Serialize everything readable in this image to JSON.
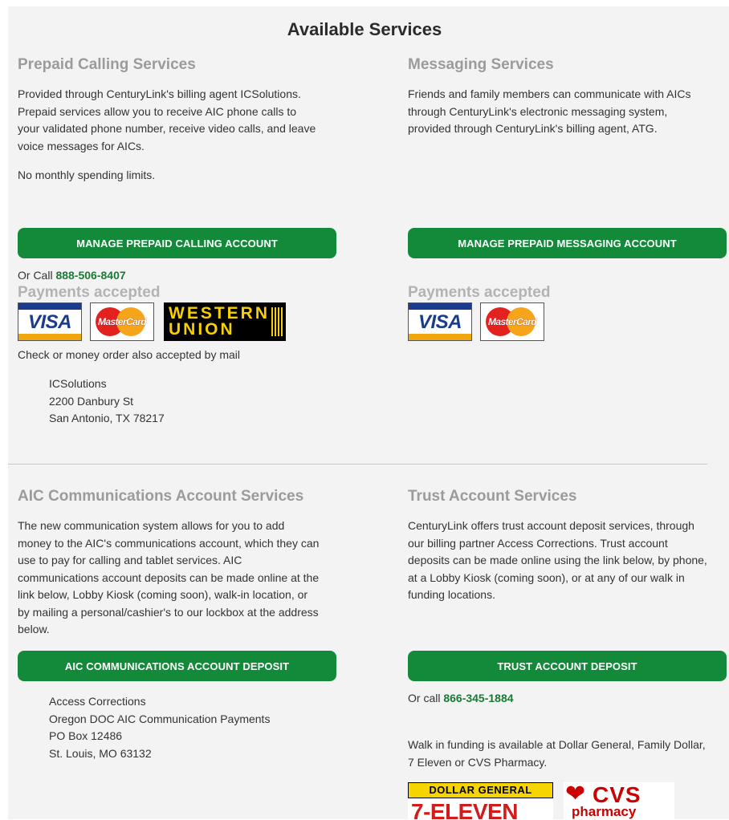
{
  "page_title": "Available Services",
  "prepaid": {
    "title": "Prepaid Calling Services",
    "desc_lines": [
      "Provided through CenturyLink's billing agent ICSolutions.",
      "Prepaid services allow you to receive AIC phone calls to",
      "your validated phone number, receive video calls, and leave",
      "voice messages for AICs."
    ],
    "limits": "No monthly spending limits.",
    "button_label": "MANAGE PREPAID CALLING ACCOUNT",
    "call_prefix": "Or Call",
    "call_number": "888-506-8407",
    "payments_title": "Payments accepted",
    "mail_note": "Check or money order also accepted by mail",
    "address": [
      "ICSolutions",
      "2200 Danbury St",
      "San Antonio, TX 78217"
    ]
  },
  "messaging": {
    "title": "Messaging Services",
    "desc_lines": [
      "Friends and family members can communicate with AICs",
      "through CenturyLink's electronic messaging system,",
      "provided through CenturyLink's billing agent, ATG."
    ],
    "button_label": "MANAGE PREPAID MESSAGING ACCOUNT",
    "payments_title": "Payments accepted"
  },
  "aic": {
    "title": "AIC Communications Account Services",
    "desc_lines": [
      "The new communication system allows for you to add",
      "money to the AIC's communications account, which they can",
      "use to pay for calling and tablet services. AIC",
      "communications account deposits can be made online at the",
      "link below, Lobby Kiosk (coming soon), walk-in location, or",
      "by mailing a personal/cashier's to our lockbox at the address",
      "below."
    ],
    "button_label": "AIC COMMUNICATIONS ACCOUNT DEPOSIT",
    "address": [
      "Access Corrections",
      "Oregon DOC AIC Communication Payments",
      "PO Box 12486",
      "St. Louis, MO 63132"
    ]
  },
  "trust": {
    "title": "Trust Account Services",
    "desc_lines": [
      "CenturyLink offers trust account deposit services, through",
      "our billing partner Access Corrections. Trust account",
      "deposits can be made online using the link below, by phone,",
      "at a Lobby Kiosk (coming soon), or at any of our walk in",
      "funding locations."
    ],
    "button_label": "TRUST ACCOUNT DEPOSIT",
    "call_prefix": "Or call",
    "call_number": "866-345-1884",
    "walkin_lines": [
      "Walk in funding is available at Dollar General, Family Dollar,",
      "7 Eleven or CVS Pharmacy."
    ]
  },
  "logos": {
    "visa": "VISA",
    "mastercard": "MasterCard",
    "western_union": [
      "WESTERN",
      "UNION"
    ],
    "dollar_general": "DOLLAR GENERAL",
    "seven_eleven": "7-ELEVEN",
    "cvs": "CVS",
    "cvs_sub": "pharmacy"
  },
  "colors": {
    "button_green": "#138a3a",
    "phone_green": "#1b7a34",
    "section_title_gray": "#9b9b9b",
    "panel_bg": "#f3f3f3"
  }
}
